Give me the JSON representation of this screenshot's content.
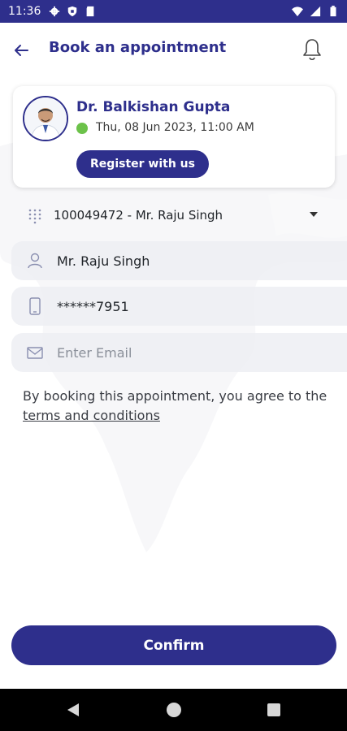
{
  "status_bar": {
    "time": "11:36",
    "icons": [
      "gear-icon",
      "shield-icon",
      "sd-card-icon",
      "wifi-icon",
      "signal-icon",
      "battery-icon"
    ]
  },
  "header": {
    "title": "Book an appointment",
    "back_icon": "arrow-left-icon",
    "bell_icon": "bell-icon"
  },
  "doctor_card": {
    "name": "Dr. Balkishan  Gupta",
    "datetime": "Thu, 08 Jun 2023, 11:00 AM",
    "register_label": "Register with us",
    "status_color": "#6cc24a"
  },
  "form": {
    "patient_select": {
      "value": "100049472 - Mr. Raju  Singh",
      "icon": "dialpad-icon"
    },
    "name": {
      "value": "Mr. Raju  Singh",
      "icon": "user-icon"
    },
    "phone": {
      "value": "******7951",
      "icon": "mobile-phone-icon"
    },
    "email": {
      "value": "",
      "placeholder": "Enter Email",
      "icon": "envelope-icon"
    }
  },
  "terms": {
    "prefix": "By booking this appointment, you agree to the ",
    "link": "terms and conditions"
  },
  "confirm_label": "Confirm",
  "theme": {
    "primary": "#2e2f8c",
    "field_bg": "#eceef3"
  },
  "nav_bar": {
    "icons": [
      "back-triangle-icon",
      "home-circle-icon",
      "recents-square-icon"
    ]
  }
}
